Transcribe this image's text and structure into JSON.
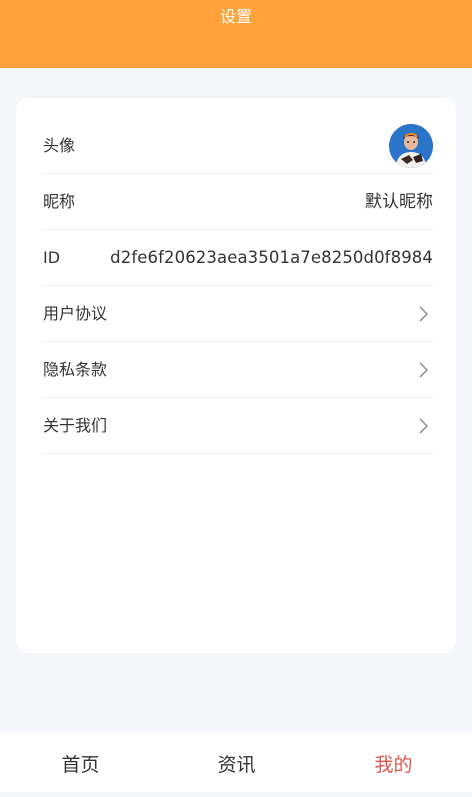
{
  "header": {
    "title": "设置"
  },
  "settings": {
    "avatar": {
      "label": "头像",
      "icon": "user-avatar-icon"
    },
    "nickname": {
      "label": "昵称",
      "value": "默认昵称"
    },
    "id": {
      "label": "ID",
      "value": "d2fe6f20623aea3501a7e8250d0f8984"
    },
    "user_agreement": {
      "label": "用户协议",
      "icon": "chevron-right-icon"
    },
    "privacy_policy": {
      "label": "隐私条款",
      "icon": "chevron-right-icon"
    },
    "about_us": {
      "label": "关于我们",
      "icon": "chevron-right-icon"
    }
  },
  "tabbar": {
    "items": [
      {
        "label": "首页",
        "active": false
      },
      {
        "label": "资讯",
        "active": false
      },
      {
        "label": "我的",
        "active": true
      }
    ]
  },
  "colors": {
    "header_bg": "#ffa23a",
    "page_bg": "#f5f6fa",
    "active_tab": "#e0574f",
    "text": "#333333"
  }
}
